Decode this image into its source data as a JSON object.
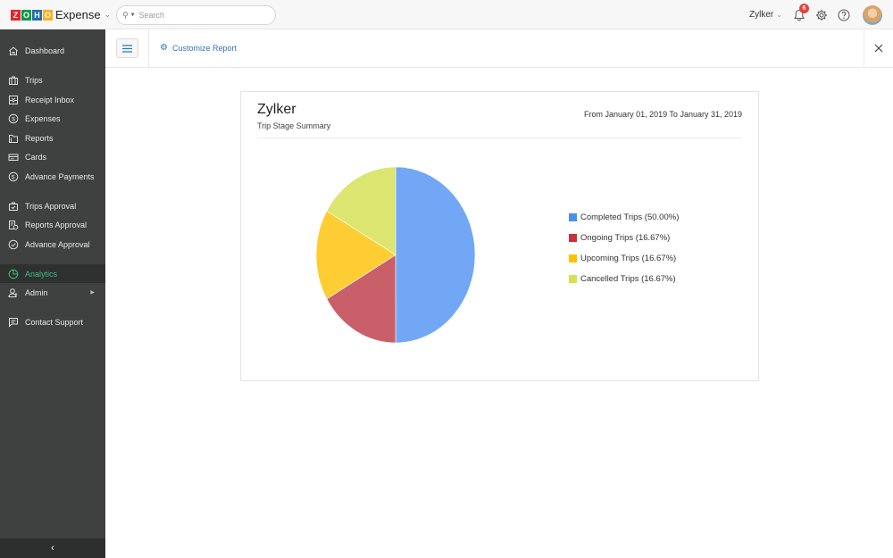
{
  "topbar": {
    "brand_letters": [
      "Z",
      "O",
      "H",
      "O"
    ],
    "brand_letter_colors": [
      "#e42527",
      "#089949",
      "#226db4",
      "#f9b21d"
    ],
    "brand_name": "Expense",
    "search_placeholder": "Search",
    "org_name": "Zylker",
    "notifications_count": "6"
  },
  "sidebar": {
    "items": [
      {
        "label": "Dashboard",
        "icon": "home-icon"
      },
      {
        "label": "Trips",
        "icon": "briefcase-icon"
      },
      {
        "label": "Receipt Inbox",
        "icon": "receipt-inbox-icon"
      },
      {
        "label": "Expenses",
        "icon": "dollar-icon"
      },
      {
        "label": "Reports",
        "icon": "folder-icon"
      },
      {
        "label": "Cards",
        "icon": "card-icon"
      },
      {
        "label": "Advance Payments",
        "icon": "advance-payment-icon"
      },
      {
        "label": "Trips Approval",
        "icon": "trip-approval-icon"
      },
      {
        "label": "Reports Approval",
        "icon": "report-approval-icon"
      },
      {
        "label": "Advance Approval",
        "icon": "check-circle-icon"
      },
      {
        "label": "Analytics",
        "icon": "analytics-icon"
      },
      {
        "label": "Admin",
        "icon": "admin-icon"
      },
      {
        "label": "Contact Support",
        "icon": "chat-icon"
      }
    ],
    "active_item": "Analytics",
    "accent_color": "#3fbf7f"
  },
  "subbar": {
    "customize_label": "Customize Report"
  },
  "report": {
    "title": "Zylker",
    "subtitle": "Trip Stage Summary",
    "date_range": "From January 01, 2019 To January 31, 2019"
  },
  "chart_data": {
    "type": "pie",
    "title": "Trip Stage Summary",
    "categories": [
      "Completed Trips",
      "Ongoing Trips",
      "Upcoming Trips",
      "Cancelled Trips"
    ],
    "values": [
      50.0,
      16.67,
      16.67,
      16.67
    ],
    "legend_labels": [
      "Completed Trips (50.00%)",
      "Ongoing Trips (16.67%)",
      "Upcoming Trips (16.67%)",
      "Cancelled Trips (16.67%)"
    ],
    "colors": [
      "#72a7f5",
      "#c95f68",
      "#fdcd33",
      "#dde571"
    ],
    "legend_colors": [
      "#4a8ff0",
      "#c5323f",
      "#fdc100",
      "#d7e04d"
    ],
    "legend_position": "right",
    "start_angle": "top, clockwise"
  }
}
